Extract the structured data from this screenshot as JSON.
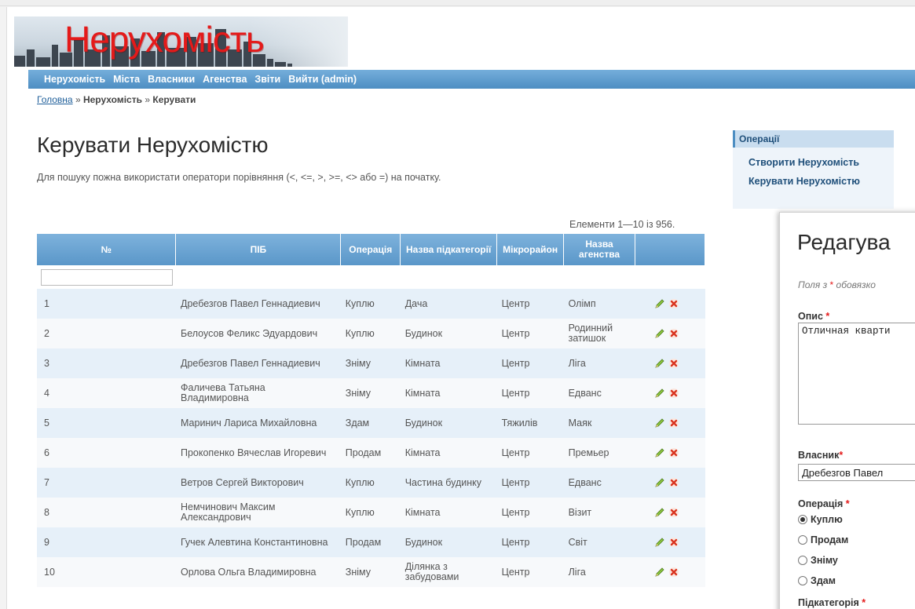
{
  "header": {
    "logo_text": "Нерухомість",
    "menu": [
      "Нерухомість",
      "Міста",
      "Власники",
      "Агенства",
      "Звіти",
      "Вийти (admin)"
    ]
  },
  "breadcrumbs": {
    "home": "Головна",
    "sep1": "»",
    "section": "Нерухомість",
    "sep2": "»",
    "current": "Керувати"
  },
  "main": {
    "title": "Керувати Нерухомістю",
    "hint": "Для пошуку пожна використати оператори порівняння (<, <=, >, >=, <> або =) на початку.",
    "summary": "Елементи 1—10 із 956."
  },
  "grid": {
    "columns": [
      "№",
      "ПІБ",
      "Операція",
      "Назва підкатегорії",
      "Мікрорайон",
      "Назва агенства"
    ],
    "filter_value": "",
    "rows": [
      {
        "n": "1",
        "name": "Дребезгов Павел Геннадиевич",
        "op": "Куплю",
        "sub": "Дача",
        "district": "Центр",
        "agency": "Олімп"
      },
      {
        "n": "2",
        "name": "Белоусов Феликс Эдуардович",
        "op": "Куплю",
        "sub": "Будинок",
        "district": "Центр",
        "agency": "Родинний затишок"
      },
      {
        "n": "3",
        "name": "Дребезгов Павел Геннадиевич",
        "op": "Зніму",
        "sub": "Кімната",
        "district": "Центр",
        "agency": "Ліга"
      },
      {
        "n": "4",
        "name": "Фаличева Татьяна Владимировна",
        "op": "Зніму",
        "sub": "Кімната",
        "district": "Центр",
        "agency": "Едванс"
      },
      {
        "n": "5",
        "name": "Маринич Лариса Михайловна",
        "op": "Здам",
        "sub": "Будинок",
        "district": "Тяжилів",
        "agency": "Маяк"
      },
      {
        "n": "6",
        "name": "Прокопенко Вячеслав Игоревич",
        "op": "Продам",
        "sub": "Кімната",
        "district": "Центр",
        "agency": "Премьер"
      },
      {
        "n": "7",
        "name": "Ветров Сергей Викторович",
        "op": "Куплю",
        "sub": "Частина будинку",
        "district": "Центр",
        "agency": "Едванс"
      },
      {
        "n": "8",
        "name": "Немчинович Максим Александрович",
        "op": "Куплю",
        "sub": "Кімната",
        "district": "Центр",
        "agency": "Візит"
      },
      {
        "n": "9",
        "name": "Гучек Алевтина Константиновна",
        "op": "Продам",
        "sub": "Будинок",
        "district": "Центр",
        "agency": "Світ"
      },
      {
        "n": "10",
        "name": "Орлова Ольга Владимировна",
        "op": "Зніму",
        "sub": "Ділянка з забудовами",
        "district": "Центр",
        "agency": "Ліга"
      }
    ],
    "actions": {
      "edit_icon": "pencil-icon",
      "delete_icon": "delete-cross-icon"
    }
  },
  "operations": {
    "title": "Операції",
    "items": [
      "Створити Нерухомість",
      "Керувати Нерухомістю"
    ]
  },
  "edit_form": {
    "title": "Редагува",
    "note_prefix": "Поля з ",
    "note_star": "*",
    "note_suffix": " обовязко",
    "required_mark": "*",
    "description_label": "Опис",
    "description_value": "Отличная кварти",
    "owner_label": "Власник",
    "owner_value": "Дребезгов Павел",
    "operation_label": "Операція",
    "operation_options": [
      "Куплю",
      "Продам",
      "Зніму",
      "Здам"
    ],
    "operation_selected": "Куплю",
    "subcategory_label": "Підкатегорія"
  },
  "colors": {
    "menu": "#5b9acc",
    "row_odd": "#e6f0f9",
    "row_even": "#f7f9fb",
    "logo_red": "#e41a1a",
    "link": "#1f4f7a"
  }
}
